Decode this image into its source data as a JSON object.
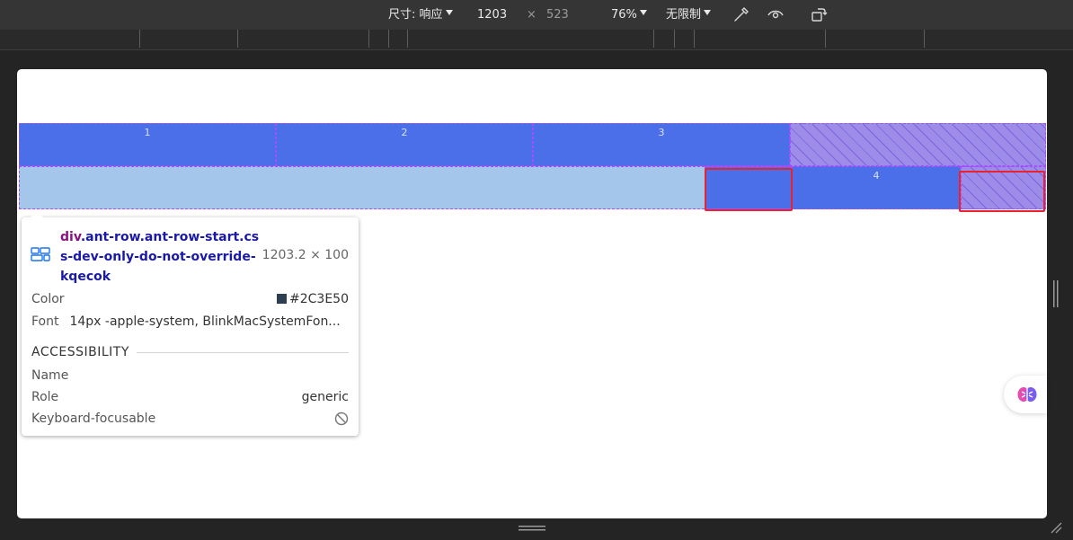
{
  "toolbar": {
    "dimensions_label": "尺寸: 响应",
    "width": "1203",
    "times": "×",
    "height": "523",
    "zoom": "76%",
    "throttle": "无限制"
  },
  "grid": {
    "row1": [
      "1",
      "2",
      "3"
    ],
    "row2_col4": "4"
  },
  "tooltip": {
    "selector_tag": "div",
    "selector_class": ".ant-row.ant-row-start.css-dev-only-do-not-override-kqecok",
    "size": "1203.2 × 100",
    "color_label": "Color",
    "color_value": "#2C3E50",
    "font_label": "Font",
    "font_value": "14px -apple-system, BlinkMacSystemFon...",
    "section_title": "ACCESSIBILITY",
    "name_label": "Name",
    "role_label": "Role",
    "role_value": "generic",
    "focus_label": "Keyboard-focusable"
  },
  "colors": {
    "col_fill": "#4a6fe8",
    "light_fill": "#a3c6ea",
    "highlight": "#e8232e",
    "swatch": "#2C3E50"
  },
  "icons": [
    "dropdown-caret-icon",
    "color-picker-icon",
    "eye-icon",
    "rotate-device-icon",
    "grid-layout-icon",
    "not-allowed-icon",
    "ai-assistant-icon"
  ]
}
